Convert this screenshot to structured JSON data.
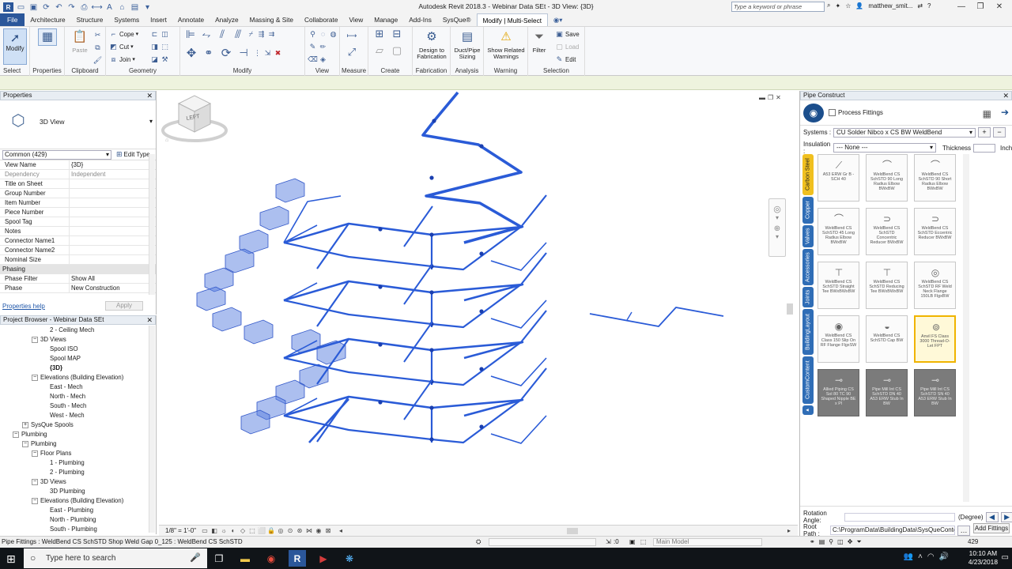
{
  "app": {
    "title": "Autodesk Revit 2018.3 -   Webinar Data SEt - 3D View: {3D}",
    "search_placeholder": "Type a keyword or phrase",
    "user": "matthew_smit..."
  },
  "menu": {
    "tabs": [
      "File",
      "Architecture",
      "Structure",
      "Systems",
      "Insert",
      "Annotate",
      "Analyze",
      "Massing & Site",
      "Collaborate",
      "View",
      "Manage",
      "Add-Ins",
      "SysQue®",
      "Modify | Multi-Select"
    ],
    "active": "Modify | Multi-Select"
  },
  "ribbon": {
    "panels": {
      "select": "Select",
      "properties": "Properties",
      "clipboard": "Clipboard",
      "geometry": "Geometry",
      "modify": "Modify",
      "view": "View",
      "measure": "Measure",
      "create": "Create",
      "fabrication": "Fabrication",
      "analysis": "Analysis",
      "warning": "Warning",
      "selection": "Selection"
    },
    "buttons": {
      "modify": "Modify",
      "paste": "Paste",
      "cope": "Cope",
      "cut": "Cut",
      "join": "Join",
      "design_to_fabrication": "Design to Fabrication",
      "duct_pipe_sizing": "Duct/Pipe Sizing",
      "show_related_warnings": "Show Related Warnings",
      "filter": "Filter",
      "save": "Save",
      "load": "Load",
      "edit": "Edit"
    }
  },
  "properties": {
    "title": "Properties",
    "type_name": "3D View",
    "instance_selector": "Common (429)",
    "edit_type": "Edit Type",
    "rows": [
      {
        "k": "View Name",
        "v": "{3D}",
        "gray": false
      },
      {
        "k": "Dependency",
        "v": "Independent",
        "gray": true
      },
      {
        "k": "Title on Sheet",
        "v": "",
        "gray": false
      },
      {
        "k": "Group Number",
        "v": "",
        "gray": false
      },
      {
        "k": "Item Number",
        "v": "",
        "gray": false
      },
      {
        "k": "Piece Number",
        "v": "",
        "gray": false
      },
      {
        "k": "Spool Tag",
        "v": "",
        "gray": false
      },
      {
        "k": "Notes",
        "v": "",
        "gray": false
      },
      {
        "k": "Connector Name1",
        "v": "",
        "gray": false
      },
      {
        "k": "Connector Name2",
        "v": "",
        "gray": false
      },
      {
        "k": "Nominal Size",
        "v": "",
        "gray": false
      }
    ],
    "group": "Phasing",
    "phase_rows": [
      {
        "k": "Phase Filter",
        "v": "Show All"
      },
      {
        "k": "Phase",
        "v": "New Construction"
      }
    ],
    "help": "Properties help",
    "apply": "Apply"
  },
  "browser": {
    "title": "Project Browser - Webinar Data SEt",
    "nodes": [
      {
        "label": "2 - Ceiling Mech",
        "indent": 4,
        "toggle": ""
      },
      {
        "label": "3D Views",
        "indent": 3,
        "toggle": "-"
      },
      {
        "label": "Spool ISO",
        "indent": 4,
        "toggle": ""
      },
      {
        "label": "Spool MAP",
        "indent": 4,
        "toggle": ""
      },
      {
        "label": "{3D}",
        "indent": 4,
        "toggle": "",
        "bold": true
      },
      {
        "label": "Elevations (Building Elevation)",
        "indent": 3,
        "toggle": "-"
      },
      {
        "label": "East - Mech",
        "indent": 4,
        "toggle": ""
      },
      {
        "label": "North - Mech",
        "indent": 4,
        "toggle": ""
      },
      {
        "label": "South - Mech",
        "indent": 4,
        "toggle": ""
      },
      {
        "label": "West - Mech",
        "indent": 4,
        "toggle": ""
      },
      {
        "label": "SysQue Spools",
        "indent": 2,
        "toggle": "+"
      },
      {
        "label": "Plumbing",
        "indent": 1,
        "toggle": "-"
      },
      {
        "label": "Plumbing",
        "indent": 2,
        "toggle": "-"
      },
      {
        "label": "Floor Plans",
        "indent": 3,
        "toggle": "-"
      },
      {
        "label": "1 - Plumbing",
        "indent": 4,
        "toggle": ""
      },
      {
        "label": "2 - Plumbing",
        "indent": 4,
        "toggle": ""
      },
      {
        "label": "3D Views",
        "indent": 3,
        "toggle": "-"
      },
      {
        "label": "3D Plumbing",
        "indent": 4,
        "toggle": ""
      },
      {
        "label": "Elevations (Building Elevation)",
        "indent": 3,
        "toggle": "-"
      },
      {
        "label": "East - Plumbing",
        "indent": 4,
        "toggle": ""
      },
      {
        "label": "North - Plumbing",
        "indent": 4,
        "toggle": ""
      },
      {
        "label": "South - Plumbing",
        "indent": 4,
        "toggle": ""
      }
    ]
  },
  "canvas": {
    "viewcube_label": "LEFT",
    "scale": "1/8\" = 1'-0\"",
    "pipe_color": "#2a5bd7",
    "duct_color": "#5a7fe0"
  },
  "pipe_construct": {
    "title": "Pipe Construct",
    "process_fittings": "Process Fittings",
    "systems_label": "Systems :",
    "systems_value": "CU Solder Nibco x CS BW WeldBend",
    "insulation_label": "Insulation :",
    "insulation_value": "--- None ---",
    "thickness_label": "Thickness",
    "thickness_unit": "Inch",
    "side_tabs": [
      "Carbon Steel",
      "Copper",
      "Valves",
      "Accessories",
      "Joints",
      "BuildingLayout",
      "CustomContent"
    ],
    "active_side_tab": "Carbon Steel",
    "fittings": [
      "A53 ERW Gr B - SCH 40",
      "WeldBend CS SchSTD 90 Long Radius Elbow BWxBW",
      "WeldBend CS SchSTD 90 Short Radius Elbow BWxBW",
      "WeldBend CS SchSTD 45 Long Radius Elbow BWxBW",
      "WeldBend CS SchSTD Concentric Reducer BWxBW",
      "WeldBend CS SchSTD Eccentric Reducer BWxBW",
      "WeldBend CS SchSTD Straight Tee BWxBWxBW",
      "WeldBend CS SchSTD Reducing Tee BWxBWxBW",
      "WeldBend CS SchSTD RF Weld Neck Flange 150LB FlgxBW",
      "WeldBend CS Class 150 Slip On RF Flange FlgxSW",
      "WeldBend CS SchSTD Cap BW",
      "Anvil FS Class 3000 Thread-O-Let FPT",
      "Allied Piping CS Sol 80 TC 90 Shaped Nipple BE x Pl",
      "Pipe Mill Int CS SchSTD DN 40 A53 ERW Stub In BW",
      "Pipe Mill Int CS SchSTD SN 40 A53 ERW Stub In BW"
    ],
    "selected_fitting": 11,
    "dark_fittings": [
      12,
      13,
      14
    ],
    "rotation_label": "Rotation Angle:",
    "rotation_unit": "(Degree)",
    "root_path_label": "Root Path :",
    "root_path_value": "C:\\ProgramData\\BuildingData\\SysQueConte",
    "add_fittings": "Add Fittings"
  },
  "status": {
    "text": "Pipe Fittings : WeldBend CS SchSTD Shop Weld Gap 0_125 : WeldBend CS SchSTD",
    "workset": ":0",
    "model": "Main Model",
    "count": "429"
  },
  "taskbar": {
    "search": "Type here to search",
    "time": "10:10 AM",
    "date": "4/23/2018"
  }
}
